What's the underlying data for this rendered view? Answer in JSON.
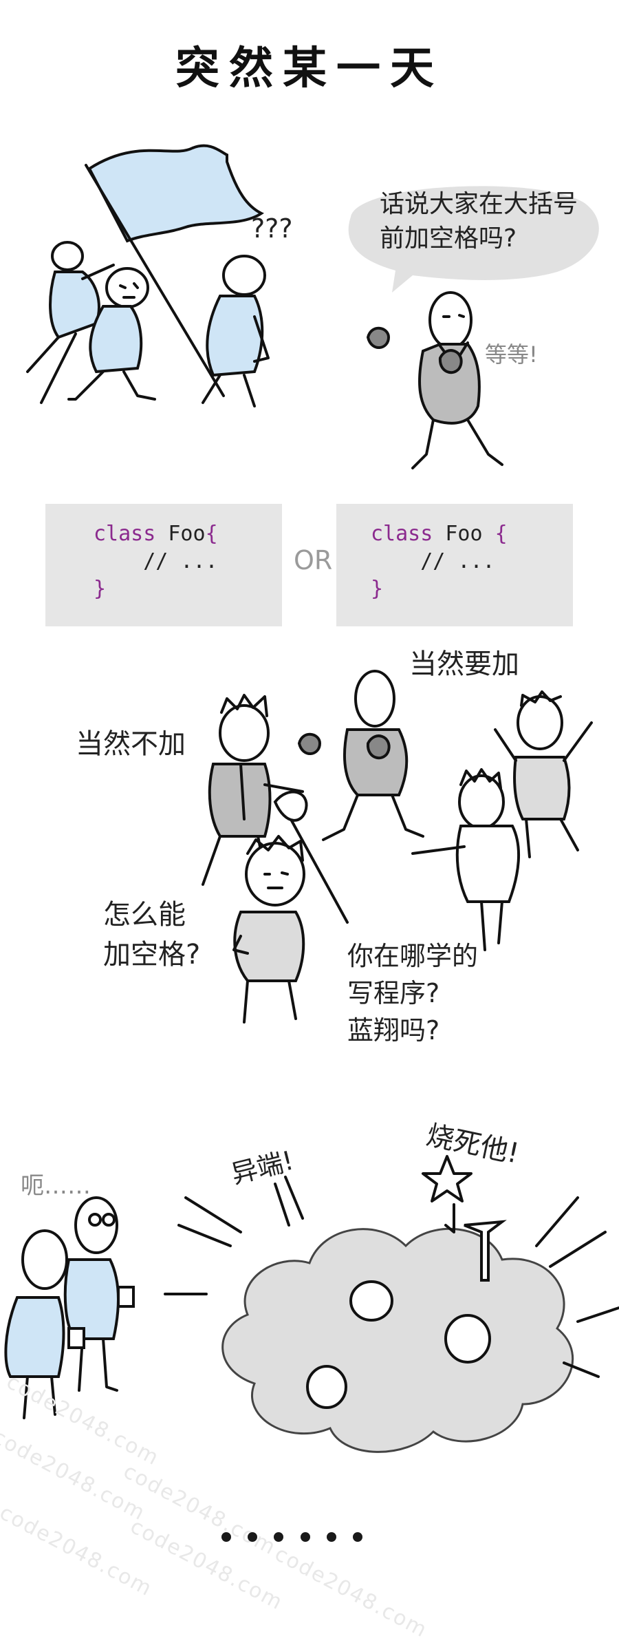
{
  "title": "突然某一天",
  "panel1": {
    "question_marks": "???",
    "speech_bubble": [
      "话说大家在大括号",
      "前加空格吗?"
    ],
    "wait_text": "等等!"
  },
  "code_options": {
    "left": {
      "keyword": "class",
      "name": "Foo",
      "open_brace": "{",
      "comment": "// ...",
      "close_brace": "}"
    },
    "separator": "OR",
    "right": {
      "keyword": "class",
      "name": "Foo",
      "open_brace": "{",
      "comment": "// ...",
      "close_brace": "}"
    }
  },
  "panel2": {
    "no_space": "当然不加",
    "yes_space": "当然要加",
    "how_can": [
      "怎么能",
      "加空格?"
    ],
    "where_learned": [
      "你在哪学的",
      "写程序?",
      "蓝翔吗?"
    ]
  },
  "panel3": {
    "uh": "呃……",
    "heretic": "异端!",
    "burn": "烧死他!"
  },
  "pagination": {
    "dot_count": 6
  },
  "watermark": "code2048.com",
  "colors": {
    "shirt_blue": "#cfe5f6",
    "vest_grey": "#bcbcbc",
    "keyword_purple": "#8b2a8e",
    "code_bg": "#e6e6e6"
  }
}
